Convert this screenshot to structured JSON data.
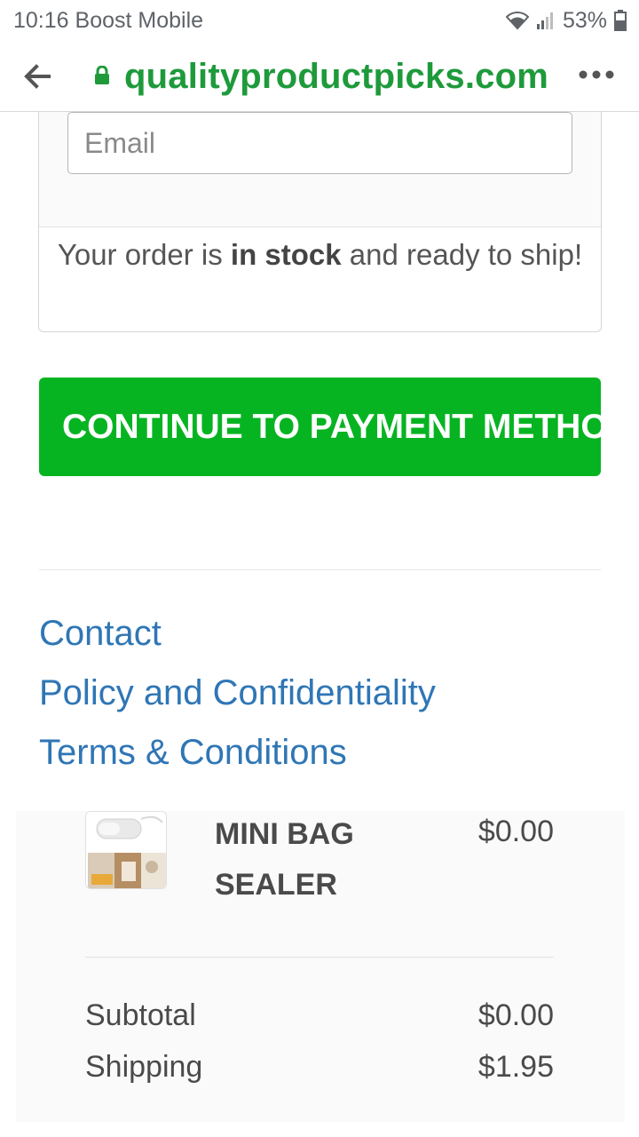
{
  "status_bar": {
    "time": "10:16",
    "carrier": "Boost Mobile",
    "battery": "53%",
    "icons": [
      "wifi-icon",
      "signal-icon",
      "battery-icon"
    ]
  },
  "browser": {
    "url": "qualityproductpicks.com",
    "icons": [
      "back-arrow-icon",
      "lock-icon",
      "more-options-icon"
    ]
  },
  "form": {
    "email_placeholder": "Email",
    "stock_prefix": "Your order is ",
    "stock_bold": "in stock",
    "stock_suffix": " and ready to ship!"
  },
  "continue_button": {
    "label": "CONTINUE TO PAYMENT METHOD"
  },
  "footer_links": {
    "contact": "Contact",
    "policy": "Policy and Confidentiality",
    "terms": "Terms & Conditions"
  },
  "order_summary": {
    "product": {
      "name": "MINI BAG SEALER",
      "price": "$0.00"
    },
    "subtotal_label": "Subtotal",
    "subtotal_value": "$0.00",
    "shipping_label": "Shipping",
    "shipping_value": "$1.95"
  },
  "colors": {
    "brand_green": "#06b421",
    "url_green": "#1e9a3b",
    "link_blue": "#2f76b5"
  }
}
